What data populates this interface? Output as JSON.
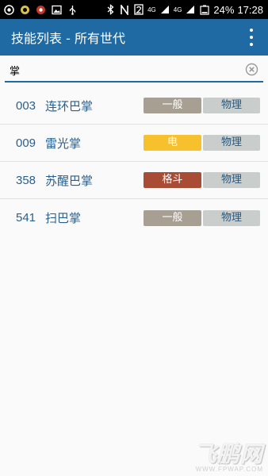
{
  "status_bar": {
    "network_label": "4G",
    "network_label_2": "4G",
    "battery": "24%",
    "time": "17:28",
    "icons": [
      "app-icon",
      "app-icon",
      "app-icon",
      "image-icon",
      "usb-icon",
      "bluetooth-icon",
      "nfc-icon",
      "sim2-icon",
      "signal-icon",
      "signal-icon",
      "battery-icon"
    ]
  },
  "app_bar": {
    "title": "技能列表 - 所有世代",
    "menu_icon": "overflow-menu-icon"
  },
  "search": {
    "value": "掌",
    "clear_icon": "clear-icon"
  },
  "skills": [
    {
      "number": "003",
      "name": "连环巴掌",
      "type": "一般",
      "type_color": "#a89f93",
      "category": "物理"
    },
    {
      "number": "009",
      "name": "雷光掌",
      "type": "电",
      "type_color": "#f7c02d",
      "category": "物理"
    },
    {
      "number": "358",
      "name": "苏醒巴掌",
      "type": "格斗",
      "type_color": "#a84c35",
      "category": "物理"
    },
    {
      "number": "541",
      "name": "扫巴掌",
      "type": "一般",
      "type_color": "#a89f93",
      "category": "物理"
    }
  ],
  "colors": {
    "app_bar": "#1f6aa3",
    "accent": "#1f6aa3",
    "skill_text": "#2a5f8c",
    "category_badge": "#c9cecd",
    "category_text": "#2d5778"
  },
  "watermark": {
    "logo": "飞鹏网",
    "url": "WWW.FPWAP.COM"
  }
}
